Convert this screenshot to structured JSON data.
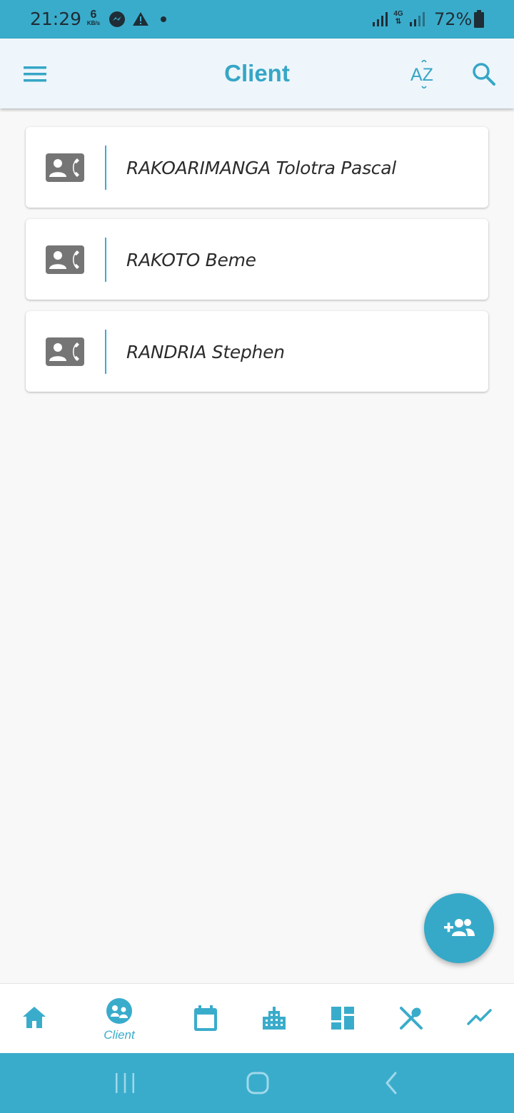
{
  "status_bar": {
    "time": "21:29",
    "net_speed_value": "6",
    "net_speed_unit": "KB/s",
    "network_type": "4G",
    "battery": "72%",
    "icons": [
      "messenger-icon",
      "warning-icon",
      "dot-icon",
      "signal-icon",
      "battery-icon"
    ]
  },
  "app_bar": {
    "title": "Client",
    "sort_label": "AZ",
    "icons": [
      "menu-icon",
      "sort-az-icon",
      "search-icon"
    ]
  },
  "clients": [
    {
      "name": "RAKOARIMANGA Tolotra Pascal",
      "icon": "contact-phone-icon"
    },
    {
      "name": "RAKOTO Beme",
      "icon": "contact-phone-icon"
    },
    {
      "name": "RANDRIA Stephen",
      "icon": "contact-phone-icon"
    }
  ],
  "fab": {
    "icon": "add-group-icon"
  },
  "bottom_nav": {
    "active_label": "Client",
    "items": [
      "home-icon",
      "client-icon",
      "calendar-icon",
      "building-icon",
      "dashboard-icon",
      "restaurant-icon",
      "trending-icon"
    ]
  },
  "colors": {
    "accent": "#3aaccb",
    "status_bar": "#3aaccb",
    "app_bar_bg": "#eef6fb",
    "card_icon": "#757575",
    "background": "#f8f8f8"
  }
}
